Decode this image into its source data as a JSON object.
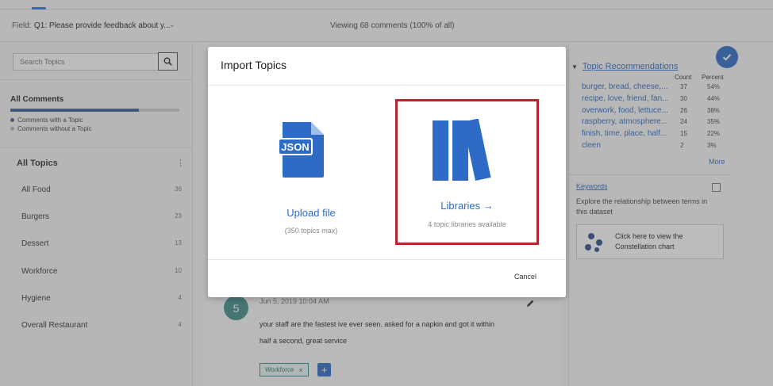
{
  "field_bar": {
    "label": "Field:",
    "value": "Q1: Please provide feedback about y...",
    "viewing": "Viewing 68 comments (100% of all)"
  },
  "sidebar": {
    "search_placeholder": "Search Topics",
    "all_comments": "All Comments",
    "topic_coverage_fraction": 0.76,
    "legend_with": "Comments with a Topic",
    "legend_without": "Comments without a Topic",
    "all_topics": "All Topics",
    "topics": [
      {
        "label": "All Food",
        "count": "36"
      },
      {
        "label": "Burgers",
        "count": "23"
      },
      {
        "label": "Dessert",
        "count": "13"
      },
      {
        "label": "Workforce",
        "count": "10"
      },
      {
        "label": "Hygiene",
        "count": "4"
      },
      {
        "label": "Overall Restaurant",
        "count": "4"
      }
    ]
  },
  "comment": {
    "number": "5",
    "date": "Jun 5, 2019 10:04 AM",
    "line1": "your staff are the fastest ive ever seen. asked for a napkin and got it within",
    "line2": "half a second, great service",
    "tag": "Workforce",
    "tag_remove": "×",
    "add": "+"
  },
  "recommendations": {
    "title": "Topic Recommendations",
    "count_header": "Count",
    "percent_header": "Percent",
    "rows": [
      {
        "label": "burger, bread, cheese,...",
        "count": "37",
        "percent": "54%"
      },
      {
        "label": "recipe, love, friend, fan...",
        "count": "30",
        "percent": "44%"
      },
      {
        "label": "overwork, food, lettuce...",
        "count": "26",
        "percent": "38%"
      },
      {
        "label": "raspberry, atmosphere...",
        "count": "24",
        "percent": "35%"
      },
      {
        "label": "finish, time, place, half...",
        "count": "15",
        "percent": "22%"
      },
      {
        "label": "cleen",
        "count": "2",
        "percent": "3%"
      }
    ],
    "more": "More"
  },
  "keywords": {
    "title": "Keywords",
    "description": "Explore the relationship between terms in this dataset",
    "constellation": "Click here to view the Constellation chart"
  },
  "modal": {
    "title": "Import Topics",
    "upload_label": "Upload file",
    "upload_sub": "(350 topics max)",
    "json_text": "JSON",
    "libraries_label": "Libraries →",
    "libraries_sub": "4 topic libraries available",
    "cancel": "Cancel"
  },
  "colors": {
    "accent": "#2e6bc7",
    "highlight_border": "#b3282d",
    "avatar": "#3f8f8c"
  }
}
